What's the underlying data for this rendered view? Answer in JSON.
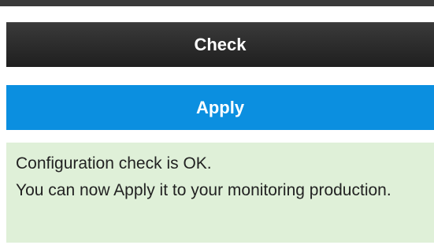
{
  "buttons": {
    "check_label": "Check",
    "apply_label": "Apply"
  },
  "message": {
    "line1": "Configuration check is OK.",
    "line2": "You can now Apply it to your monitoring production."
  },
  "colors": {
    "check_bg": "#262626",
    "apply_bg": "#0b8fe0",
    "success_bg": "#dff0d8"
  }
}
